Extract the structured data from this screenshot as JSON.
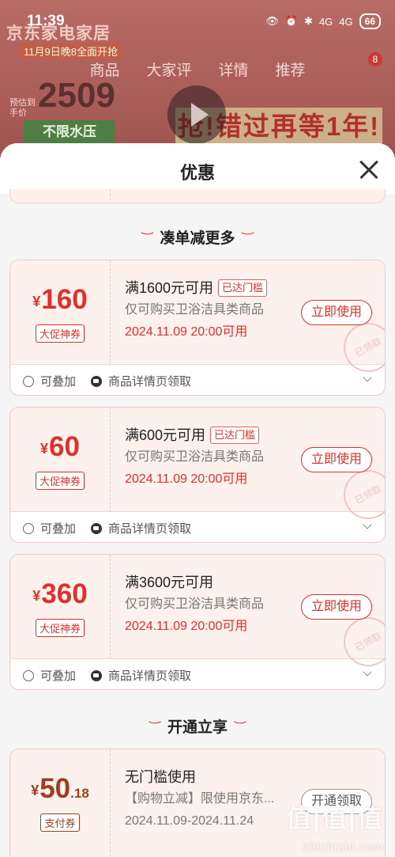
{
  "status": {
    "time": "11:39",
    "signal1": "4G",
    "signal2": "4G",
    "battery": "66"
  },
  "background": {
    "banner": "京东家电家居",
    "date_banner": "11月9日晚8全面开抢",
    "tabs": [
      "商品",
      "大家评",
      "详情",
      "推荐"
    ],
    "price_label": "预估到手价",
    "price": "2509",
    "pill": "不限水压",
    "slogan": "抢!错过再等1年!",
    "badge": "8"
  },
  "sheet": {
    "title": "优惠",
    "section1": "凑单减更多",
    "section2": "开通立享",
    "coupons": [
      {
        "yen": "¥",
        "amount": "160",
        "decimal": "",
        "tag": "大促神券",
        "condition": "满1600元可用",
        "reached": "已达门槛",
        "scope": "仅可购买卫浴洁具类商品",
        "time": "2024.11.09 20:00可用",
        "button": "立即使用",
        "stamp": "已领取",
        "stackable": "可叠加",
        "source": "商品详情页领取"
      },
      {
        "yen": "¥",
        "amount": "60",
        "decimal": "",
        "tag": "大促神券",
        "condition": "满600元可用",
        "reached": "已达门槛",
        "scope": "仅可购买卫浴洁具类商品",
        "time": "2024.11.09 20:00可用",
        "button": "立即使用",
        "stamp": "已领取",
        "stackable": "可叠加",
        "source": "商品详情页领取"
      },
      {
        "yen": "¥",
        "amount": "360",
        "decimal": "",
        "tag": "大促神券",
        "condition": "满3600元可用",
        "reached": "",
        "scope": "仅可购买卫浴洁具类商品",
        "time": "2024.11.09 20:00可用",
        "button": "立即使用",
        "stamp": "已领取",
        "stackable": "可叠加",
        "source": "商品详情页领取"
      },
      {
        "yen": "¥",
        "amount": "50",
        "decimal": ".18",
        "tag": "支付券",
        "condition": "无门槛使用",
        "reached": "",
        "scope": "【购物立减】限使用京东...",
        "time": "2024.11.09-2024.11.24",
        "button": "开通领取",
        "stamp": "",
        "stackable": "",
        "source": ""
      }
    ]
  },
  "watermark": {
    "text": "值|值|值",
    "url": "zhizhizhi.com"
  }
}
